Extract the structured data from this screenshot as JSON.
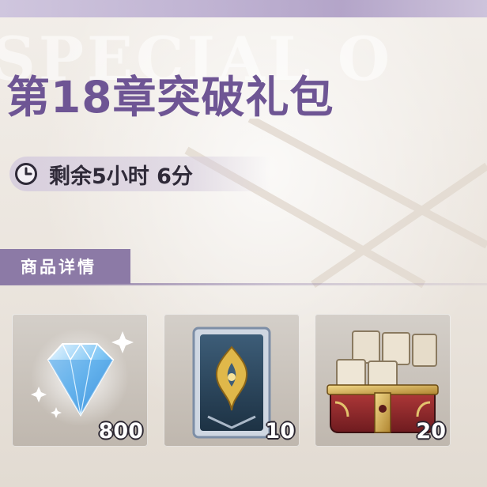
{
  "package": {
    "watermark": "SPECIAL O",
    "title": "第18章突破礼包",
    "timer_text": "剩余5小时 6分"
  },
  "section": {
    "label": "商品详情"
  },
  "items": [
    {
      "name_icon": "diamond-icon",
      "quantity": "800"
    },
    {
      "name_icon": "card-icon",
      "quantity": "10"
    },
    {
      "name_icon": "treasure-chest-icon",
      "quantity": "20"
    }
  ],
  "colors": {
    "title": "#6e5594",
    "section_bg": "#8c7aa6",
    "timer_bg": "#d6cdde"
  }
}
